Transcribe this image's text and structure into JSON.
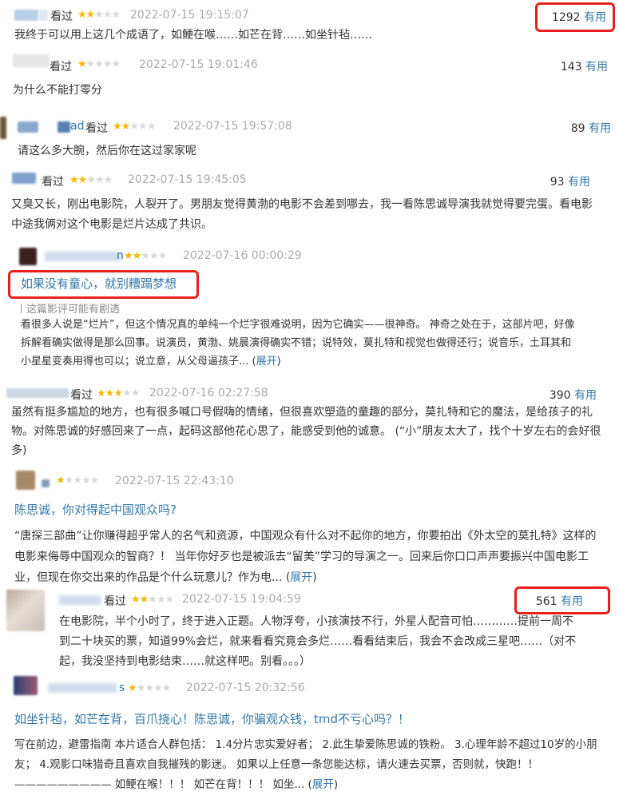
{
  "labels": {
    "watched": "看过",
    "useful": "有用",
    "expand": "展开"
  },
  "colors": {
    "link": "#3377aa",
    "star": "#f5b800",
    "highlight_box": "#e8201b"
  },
  "reviews": [
    {
      "name_fragment": "",
      "rating": 2,
      "time": "2022-07-15 19:15:07",
      "useful": "1292",
      "text": "我终于可以用上这几个成语了，如鲠在喉……如芒在背……如坐针毡……"
    },
    {
      "name_fragment": "",
      "rating": 1,
      "time": "2022-07-15 19:01:46",
      "useful": "143",
      "text": "为什么不能打零分"
    },
    {
      "name_fragment": "ad",
      "rating": 2,
      "time": "2022-07-15 19:57:08",
      "useful": "89",
      "text": "请这么多大腕，然后你在这过家家呢"
    },
    {
      "name_fragment": "",
      "rating": 2,
      "time": "2022-07-15 19:45:05",
      "useful": "93",
      "text": "又臭又长，刚出电影院，人裂开了。男朋友觉得黄渤的电影不会差到哪去，我一看陈思诚导演我就觉得要完蛋。看电影中途我俩对这个电影是烂片达成了共识。"
    },
    {
      "name_fragment": "n",
      "rating": 2,
      "time": "2022-07-16 00:00:29",
      "title": "如果没有童心，就别糟蹋梦想",
      "spoiler": "这篇影评可能有剧透",
      "text": "看很多人说是“烂片”，但这个情况真的单纯一个烂字很难说明，因为它确实——很神奇。 神奇之处在于，这部片吧，好像拆解看确实做得是那么回事。说演员，黄渤、姚晨演得确实不错；说特效，莫扎特和视觉也做得还行；说音乐，土耳其和小星星变奏用得也可以；说立意，从父母逼孩子... "
    },
    {
      "name_fragment": "",
      "rating": 3,
      "time": "2022-07-16 02:27:58",
      "useful": "390",
      "text": "虽然有挺多尴尬的地方，也有很多喊口号假嗨的情绪，但很喜欢塑造的童趣的部分，莫扎特和它的魔法，是给孩子的礼物。对陈思诚的好感回来了一点，起码这部他花心思了，能感受到他的诚意。 (“小”朋友太大了，找个十岁左右的会好很多)"
    },
    {
      "name_fragment": "",
      "rating": 1,
      "time": "2022-07-15 22:43:10",
      "title": "陈思诚，你对得起中国观众吗?",
      "text": "“唐探三部曲”让你赚得超乎常人的名气和资源，中国观众有什么对不起你的地方，你要拍出《外太空的莫扎特》这样的电影来侮辱中国观众的智商？！ 当年你好歹也是被派去“留美”学习的导演之一。回来后你口口声声要振兴中国电影工业，但现在你交出来的作品是个什么玩意儿？作为电... "
    },
    {
      "name_fragment": "",
      "rating": 2,
      "time": "2022-07-15 19:04:59",
      "useful": "561",
      "text": "在电影院，半个小时了，终于进入正题。人物浮夸，小孩演技不行，外星人配音可怕…………提前一周不到二十块买的票，知道99%会烂，就来看看究竟会多烂……看看结束后，我会不会改成三星吧……（对不起，我没坚持到电影结束……就这样吧。别看。。。）"
    },
    {
      "name_fragment": "s",
      "rating": 1,
      "time": "2022-07-15 20:32:56",
      "title": "如坐针毡，如芒在背，百爪挠心！陈思诚，你骗观众钱，tmd不亏心吗？！",
      "text": "写在前边，避雷指南 本片适合人群包括： 1.4分片忠实爱好者； 2.此生挚爱陈思诚的铁粉。 3.心理年龄不超过10岁的小朋友； 4.观影口味猎奇且喜欢自我摧残的影迷。 如果以上任意一条您能达标，请火速去买票，否则就，快跑！！————————— 如鲠在喉！！！ 如芒在背！！！ 如坐... "
    }
  ]
}
